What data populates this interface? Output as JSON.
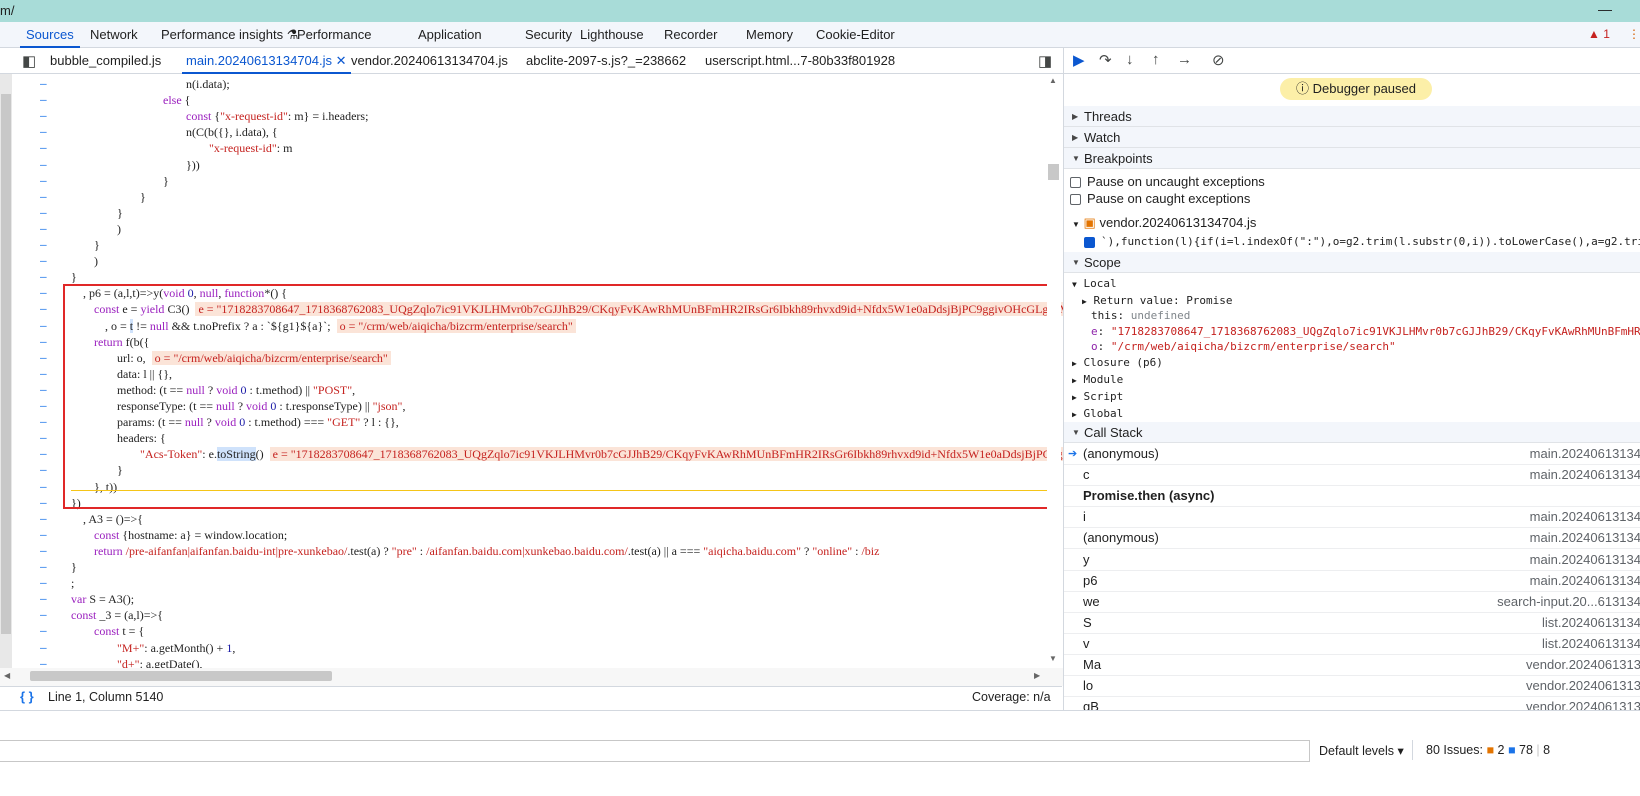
{
  "window": {
    "title_fragment": "m/",
    "minimize_glyph": "—"
  },
  "devtools_tabs": [
    "Sources",
    "Network",
    "Performance insights",
    "Performance",
    "Application",
    "Security",
    "Lighthouse",
    "Recorder",
    "Memory",
    "Cookie-Editor"
  ],
  "active_tab": "Sources",
  "counters": {
    "errors": "1"
  },
  "file_tabs": [
    {
      "label": "bubble_compiled.js"
    },
    {
      "label": "main.20240613134704.js",
      "active": true
    },
    {
      "label": "vendor.20240613134704.js"
    },
    {
      "label": "abclite-2097-s.js?_=238662"
    },
    {
      "label": "userscript.html...7-80b33f801928"
    }
  ],
  "code_lines": [
    [
      {
        "t": "n(i.data);"
      }
    ],
    [
      {
        "t": "else",
        "c": "kw"
      },
      {
        "t": " {"
      }
    ],
    [
      {
        "t": "const",
        "c": "kw"
      },
      {
        "t": " {"
      },
      {
        "t": "\"x-request-id\"",
        "c": "str"
      },
      {
        "t": ": m} = i.headers;"
      }
    ],
    [
      {
        "t": "n(C(b({}, i.data), {"
      }
    ],
    [
      {
        "t": "\"x-request-id\"",
        "c": "str"
      },
      {
        "t": ": m"
      }
    ],
    [
      {
        "t": "}))"
      }
    ],
    [
      {
        "t": "}"
      }
    ],
    [
      {
        "t": "}"
      }
    ],
    [
      {
        "t": "}"
      }
    ],
    [
      {
        "t": ")"
      }
    ],
    [
      {
        "t": "}"
      }
    ],
    [
      {
        "t": ")"
      }
    ],
    [
      {
        "t": "}"
      }
    ],
    [
      {
        "t": ", p6 = (a,l,t)=>y("
      },
      {
        "t": "void",
        "c": "kw"
      },
      {
        "t": " "
      },
      {
        "t": "0",
        "c": "nl"
      },
      {
        "t": ", "
      },
      {
        "t": "null",
        "c": "kw"
      },
      {
        "t": ", "
      },
      {
        "t": "function",
        "c": "kw"
      },
      {
        "t": "*() {"
      }
    ],
    [
      {
        "t": "const",
        "c": "kw"
      },
      {
        "t": " e = "
      },
      {
        "t": "yield",
        "c": "kw"
      },
      {
        "t": " C3()"
      },
      {
        "t": "e = \"1718283708647_1718368762083_UQgZqlo7ic91VKJLHMvr0b7cGJJhB29/CKqyFvKAwRhMUnBFmHR2IRsGr6Ibkh89rhvxd9id+Nfdx5W1e0aDdsjBjPC9ggivOHcGLgfPM+WKCix",
        "c": "inl"
      }
    ],
    [
      {
        "t": ", o = "
      },
      {
        "t": "t",
        "c": "selw"
      },
      {
        "t": " != "
      },
      {
        "t": "null",
        "c": "kw"
      },
      {
        "t": " && t.noPrefix ? a : `${g1}${a}`;"
      },
      {
        "t": "o = \"/crm/web/aiqicha/bizcrm/enterprise/search\"",
        "c": "inl"
      }
    ],
    [
      {
        "t": "return",
        "c": "kw"
      },
      {
        "t": " f(b({"
      }
    ],
    [
      {
        "t": "url: o,"
      },
      {
        "t": "o = \"/crm/web/aiqicha/bizcrm/enterprise/search\"",
        "c": "inl"
      }
    ],
    [
      {
        "t": "data: l || {},"
      }
    ],
    [
      {
        "t": "method: (t == "
      },
      {
        "t": "null",
        "c": "kw"
      },
      {
        "t": " ? "
      },
      {
        "t": "void",
        "c": "kw"
      },
      {
        "t": " "
      },
      {
        "t": "0",
        "c": "nl"
      },
      {
        "t": " : t.method) || "
      },
      {
        "t": "\"POST\"",
        "c": "str"
      },
      {
        "t": ","
      }
    ],
    [
      {
        "t": "responseType: (t == "
      },
      {
        "t": "null",
        "c": "kw"
      },
      {
        "t": " ? "
      },
      {
        "t": "void",
        "c": "kw"
      },
      {
        "t": " "
      },
      {
        "t": "0",
        "c": "nl"
      },
      {
        "t": " : t.responseType) || "
      },
      {
        "t": "\"json\"",
        "c": "str"
      },
      {
        "t": ","
      }
    ],
    [
      {
        "t": "params: (t == "
      },
      {
        "t": "null",
        "c": "kw"
      },
      {
        "t": " ? "
      },
      {
        "t": "void",
        "c": "kw"
      },
      {
        "t": " "
      },
      {
        "t": "0",
        "c": "nl"
      },
      {
        "t": " : t.method) === "
      },
      {
        "t": "\"GET\"",
        "c": "str"
      },
      {
        "t": " ? l : {},"
      }
    ],
    [
      {
        "t": "headers: {"
      }
    ],
    [
      {
        "t": "\"Acs-Token\"",
        "c": "str"
      },
      {
        "t": ": e."
      },
      {
        "t": "toString",
        "c": "selw"
      },
      {
        "t": "()"
      },
      {
        "t": "e = \"1718283708647_1718368762083_UQgZqlo7ic91VKJLHMvr0b7cGJJhB29/CKqyFvKAwRhMUnBFmHR2IRsGr6Ibkh89rhvxd9id+Nfdx5W1e0aDdsjBjPC9ggivOH",
        "c": "inl"
      }
    ],
    [
      {
        "t": "}"
      }
    ],
    [
      {
        "t": "}, t))"
      }
    ],
    [
      {
        "t": "})"
      }
    ],
    [
      {
        "t": ", A3 = ()=>{"
      }
    ],
    [
      {
        "t": "const",
        "c": "kw"
      },
      {
        "t": " {hostname: a} = window.location;"
      }
    ],
    [
      {
        "t": "return",
        "c": "kw"
      },
      {
        "t": " "
      },
      {
        "t": "/pre-aifanfan|aifanfan.baidu-int|pre-xunkebao/",
        "c": "str"
      },
      {
        "t": ".test(a) ? "
      },
      {
        "t": "\"pre\"",
        "c": "str"
      },
      {
        "t": " : "
      },
      {
        "t": "/aifanfan.baidu.com|xunkebao.baidu.com/",
        "c": "str"
      },
      {
        "t": ".test(a) || a === "
      },
      {
        "t": "\"aiqicha.baidu.com\"",
        "c": "str"
      },
      {
        "t": " ? "
      },
      {
        "t": "\"online\"",
        "c": "str"
      },
      {
        "t": " : "
      },
      {
        "t": "/biz",
        "c": "str"
      }
    ],
    [
      {
        "t": "}"
      }
    ],
    [
      {
        "t": ";"
      }
    ],
    [
      {
        "t": "var",
        "c": "kw"
      },
      {
        "t": " S = A3();"
      }
    ],
    [
      {
        "t": "const",
        "c": "kw"
      },
      {
        "t": " _3 = (a,l)=>{"
      }
    ],
    [
      {
        "t": "const",
        "c": "kw"
      },
      {
        "t": " t = {"
      }
    ],
    [
      {
        "t": "\"M+\"",
        "c": "str"
      },
      {
        "t": ": a.getMonth() + "
      },
      {
        "t": "1",
        "c": "nl"
      },
      {
        "t": ","
      }
    ],
    [
      {
        "t": "\"d+\"",
        "c": "str"
      },
      {
        "t": ": a.getDate(),"
      }
    ]
  ],
  "status": {
    "position": "Line 1, Column 5140",
    "coverage": "Coverage: n/a"
  },
  "debugger": {
    "paused_label": "Debugger paused",
    "sections": {
      "threads": "Threads",
      "watch": "Watch",
      "breakpoints": "Breakpoints",
      "scope": "Scope",
      "call_stack": "Call Stack"
    },
    "pause_uncaught": "Pause on uncaught exceptions",
    "pause_caught": "Pause on caught exceptions",
    "bp_file": "vendor.20240613134704.js",
    "bp_code": "`),function(l){if(i=l.indexOf(\":\"),o=g2.trim(l.substr(0,i)).toLowerCase(),a=g2.tri",
    "scope": {
      "local": "Local",
      "return_key": "Return value",
      "return_val": "Promise",
      "this_key": "this",
      "this_val": "undefined",
      "e_key": "e",
      "e_val": "\"1718283708647_1718368762083_UQgZqlo7ic91VKJLHMvr0b7cGJJhB29/CKqyFvKAwRhMUnBFmHR",
      "o_key": "o",
      "o_val": "\"/crm/web/aiqicha/bizcrm/enterprise/search\"",
      "closure": "Closure (p6)",
      "module": "Module",
      "script": "Script",
      "global": "Global"
    },
    "call_stack": [
      {
        "fn": "(anonymous)",
        "loc": "main.20240613134",
        "current": true
      },
      {
        "fn": "c",
        "loc": "main.20240613134"
      },
      {
        "fn": "Promise.then (async)",
        "loc": "",
        "async": true
      },
      {
        "fn": "i",
        "loc": "main.20240613134"
      },
      {
        "fn": "(anonymous)",
        "loc": "main.20240613134"
      },
      {
        "fn": "y",
        "loc": "main.20240613134"
      },
      {
        "fn": "p6",
        "loc": "main.20240613134"
      },
      {
        "fn": "we",
        "loc": "search-input.20...613134"
      },
      {
        "fn": "S",
        "loc": "list.20240613134"
      },
      {
        "fn": "v",
        "loc": "list.20240613134"
      },
      {
        "fn": "Ma",
        "loc": "vendor.2024061313"
      },
      {
        "fn": "lo",
        "loc": "vendor.2024061313"
      },
      {
        "fn": "gB",
        "loc": "vendor.2024061313"
      }
    ]
  },
  "console": {
    "default_levels": "Default levels ▾",
    "issues_label": "80 Issues:",
    "issues_errors": "2",
    "issues_info": "78",
    "issues_more": "8"
  }
}
